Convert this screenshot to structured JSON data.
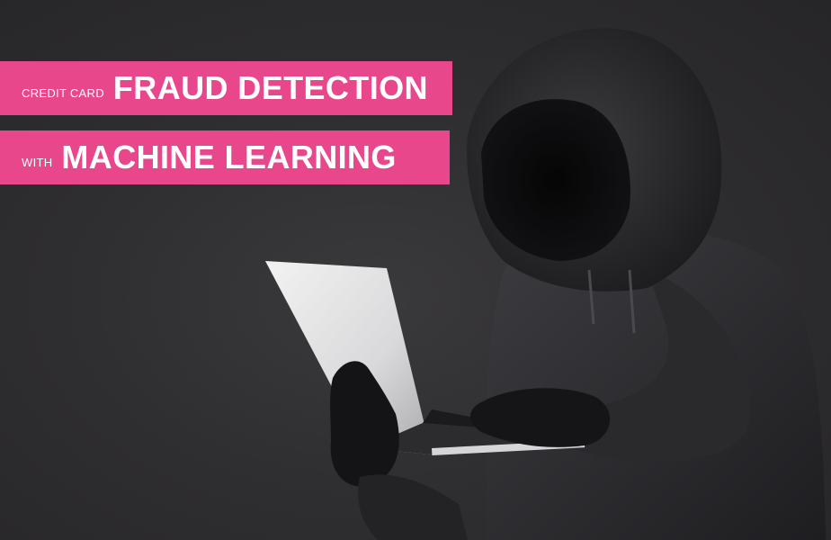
{
  "headline": {
    "line1_prefix": "CREDIT CARD",
    "line1_main": "FRAUD DETECTION",
    "line2_prefix": "WITH",
    "line2_main": "MACHINE LEARNING"
  },
  "colors": {
    "accent": "#e8478b",
    "background": "#2b2a2c",
    "text": "#ffffff"
  },
  "illustration": {
    "subject": "hooded-figure-with-laptop-icon"
  }
}
